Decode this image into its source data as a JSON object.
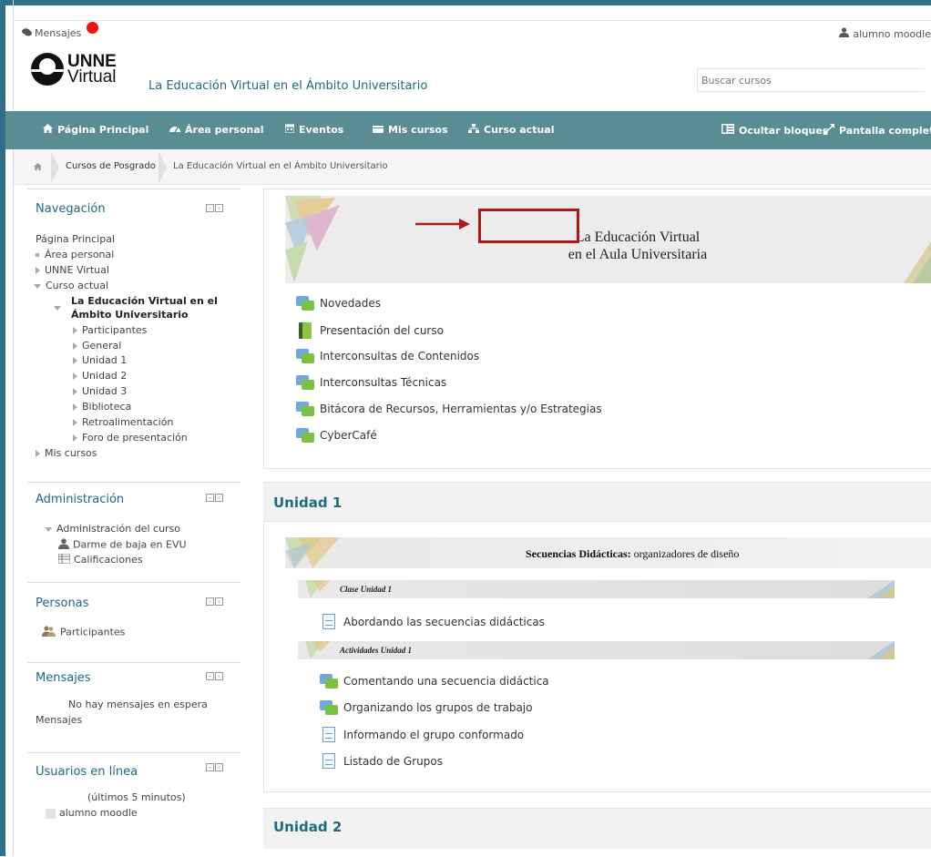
{
  "header": {
    "messages_label": "Mensajes",
    "user_name": "alumno moodle",
    "logo_line1": "UNNE",
    "logo_line2": "Virtual",
    "site_title": "La Educación Virtual en el Ámbito Universitario",
    "search_placeholder": "Buscar cursos"
  },
  "navbar": {
    "items": [
      {
        "label": "Página Principal",
        "icon": "home-icon"
      },
      {
        "label": "Área personal",
        "icon": "dashboard-icon"
      },
      {
        "label": "Eventos",
        "icon": "calendar-icon"
      },
      {
        "label": "Mis cursos",
        "icon": "courses-icon"
      },
      {
        "label": "Curso actual",
        "icon": "sitemap-icon"
      }
    ],
    "hide_blocks": "Ocultar bloques",
    "fullscreen": "Pantalla completa"
  },
  "breadcrumb": {
    "items": [
      "Cursos de Posgrado",
      "La Educación Virtual en el Ámbito Universitario"
    ]
  },
  "navigation_block": {
    "title": "Navegación",
    "home": "Página Principal",
    "personal_area": "Área personal",
    "unne_virtual": "UNNE Virtual",
    "current_course": "Curso actual",
    "course_name_line1": "La Educación Virtual en el",
    "course_name_line2": "Ámbito Universitario",
    "sections": [
      "Participantes",
      "General",
      "Unidad 1",
      "Unidad 2",
      "Unidad 3",
      "Biblioteca",
      "Retroalimentación",
      "Foro de presentación"
    ],
    "my_courses": "Mis cursos"
  },
  "admin_block": {
    "title": "Administración",
    "course_admin": "Administración del curso",
    "unenrol": "Darme de baja en EVU",
    "grades": "Calificaciones"
  },
  "people_block": {
    "title": "Personas",
    "participants": "Participantes"
  },
  "messages_block": {
    "title": "Mensajes",
    "no_messages": "No hay mensajes en espera",
    "link": "Mensajes"
  },
  "online_block": {
    "title": "Usuarios en línea",
    "period": "(últimos 5 minutos)",
    "user": "alumno moodle"
  },
  "general_section": {
    "banner_line1": "La Educación Virtual",
    "banner_line2": "en el Aula Universitaria",
    "activities": [
      {
        "label": "Novedades",
        "type": "forum"
      },
      {
        "label": "Presentación del curso",
        "type": "book"
      },
      {
        "label": "Interconsultas de Contenidos",
        "type": "forum"
      },
      {
        "label": "Interconsultas Técnicas",
        "type": "forum"
      },
      {
        "label": "Bitácora de Recursos, Herramientas y/o Estrategias",
        "type": "forum"
      },
      {
        "label": "CyberCafé",
        "type": "forum"
      }
    ]
  },
  "unit1": {
    "title": "Unidad 1",
    "banner_bold": "Secuencias Didácticas:",
    "banner_rest": " organizadores de diseño",
    "class_label": "Clase Unidad 1",
    "class_item": "Abordando las secuencias didácticas",
    "activities_label": "Actividades Unidad 1",
    "activities": [
      {
        "label": "Comentando una secuencia didáctica",
        "type": "forum"
      },
      {
        "label": "Organizando los grupos de trabajo",
        "type": "forum"
      },
      {
        "label": "Informando el grupo conformado",
        "type": "page"
      },
      {
        "label": "Listado de Grupos",
        "type": "page"
      }
    ]
  },
  "unit2": {
    "title": "Unidad 2"
  }
}
